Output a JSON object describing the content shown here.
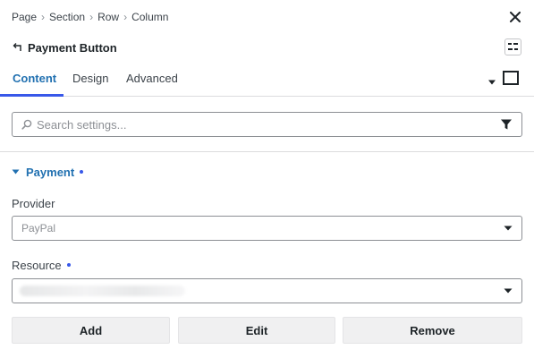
{
  "breadcrumb": {
    "items": [
      "Page",
      "Section",
      "Row",
      "Column"
    ],
    "separator": "›"
  },
  "panel": {
    "title": "Payment Button",
    "back_icon": "back-arrow-icon",
    "structure_icon": "structure-icon",
    "close_icon": "close-icon"
  },
  "tabs": {
    "items": [
      {
        "label": "Content",
        "active": true
      },
      {
        "label": "Design",
        "active": false
      },
      {
        "label": "Advanced",
        "active": false
      }
    ]
  },
  "search": {
    "placeholder": "Search settings...",
    "value": ""
  },
  "section": {
    "title": "Payment",
    "expanded": true
  },
  "fields": {
    "provider": {
      "label": "Provider",
      "value": "PayPal"
    },
    "resource": {
      "label": "Resource",
      "value": ""
    }
  },
  "actions": {
    "add": "Add",
    "edit": "Edit",
    "remove": "Remove"
  },
  "colors": {
    "accent": "#2271b1",
    "accent_indicator": "#3858e9",
    "border": "#8c8f94",
    "divider": "#dcdcde"
  }
}
